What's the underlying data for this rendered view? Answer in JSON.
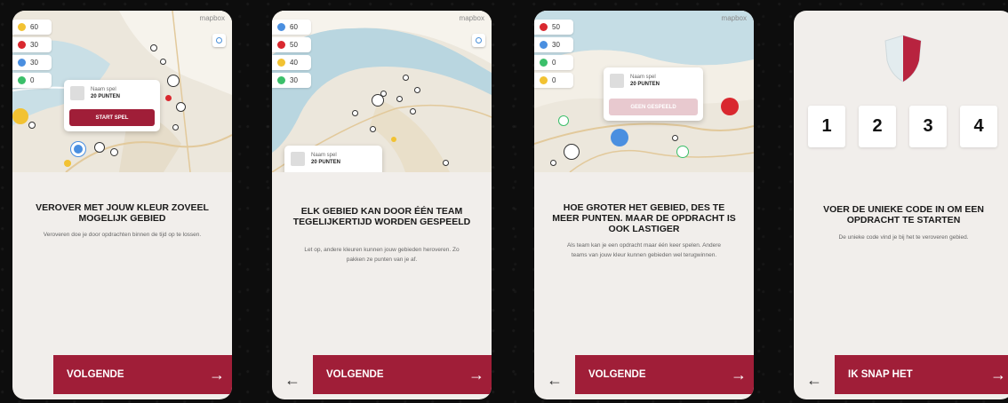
{
  "colors": {
    "accent": "#a01e38",
    "team_yellow": "#f2c232",
    "team_red": "#d9282f",
    "team_blue": "#4a8fe0",
    "team_green": "#3bbf6a"
  },
  "map": {
    "attribution": "mapbox",
    "locate_icon": "locate-icon"
  },
  "screens": [
    {
      "legend": [
        {
          "color": "#f2c232",
          "value": "60"
        },
        {
          "color": "#d9282f",
          "value": "30"
        },
        {
          "color": "#4a8fe0",
          "value": "30"
        },
        {
          "color": "#3bbf6a",
          "value": "0"
        }
      ],
      "popup": {
        "name": "Naam spel",
        "points": "20 PUNTEN",
        "button": "START SPEL"
      },
      "title": "VEROVER MET JOUW KLEUR ZOVEEL MOGELIJK GEBIED",
      "body": "Veroveren doe je door opdrachten binnen de tijd op te lossen.",
      "next_label": "VOLGENDE",
      "arrow": "→"
    },
    {
      "legend": [
        {
          "color": "#4a8fe0",
          "value": "60"
        },
        {
          "color": "#d9282f",
          "value": "50"
        },
        {
          "color": "#f2c232",
          "value": "40"
        },
        {
          "color": "#3bbf6a",
          "value": "30"
        }
      ],
      "popup": {
        "name": "Naam spel",
        "points": "20 PUNTEN"
      },
      "title": "ELK GEBIED KAN DOOR ÉÉN TEAM TEGELIJKERTIJD WORDEN GESPEELD",
      "body": "Let op, andere kleuren kunnen jouw gebieden heroveren. Zo pakken ze punten van je af.",
      "back_label": "←",
      "next_label": "VOLGENDE",
      "arrow": "→"
    },
    {
      "legend": [
        {
          "color": "#d9282f",
          "value": "50"
        },
        {
          "color": "#4a8fe0",
          "value": "30"
        },
        {
          "color": "#3bbf6a",
          "value": "0"
        },
        {
          "color": "#f2c232",
          "value": "0"
        }
      ],
      "popup": {
        "name": "Naam spel",
        "points": "20 PUNTEN",
        "button": "GEEN GESPEELD"
      },
      "title": "HOE GROTER HET GEBIED, DES TE MEER PUNTEN. MAAR DE OPDRACHT IS OOK LASTIGER",
      "body": "Als team kan je een opdracht maar één keer spelen. Andere teams van jouw kleur kunnen gebieden wel terugwinnen.",
      "back_label": "←",
      "next_label": "VOLGENDE",
      "arrow": "→"
    },
    {
      "shield_icon": "shield-icon",
      "code_digits": [
        "1",
        "2",
        "3",
        "4"
      ],
      "title": "VOER DE UNIEKE CODE IN OM EEN OPDRACHT TE STARTEN",
      "body": "De unieke code vind je bij het te veroveren gebied.",
      "back_label": "←",
      "next_label": "IK SNAP HET",
      "arrow": "→"
    }
  ]
}
